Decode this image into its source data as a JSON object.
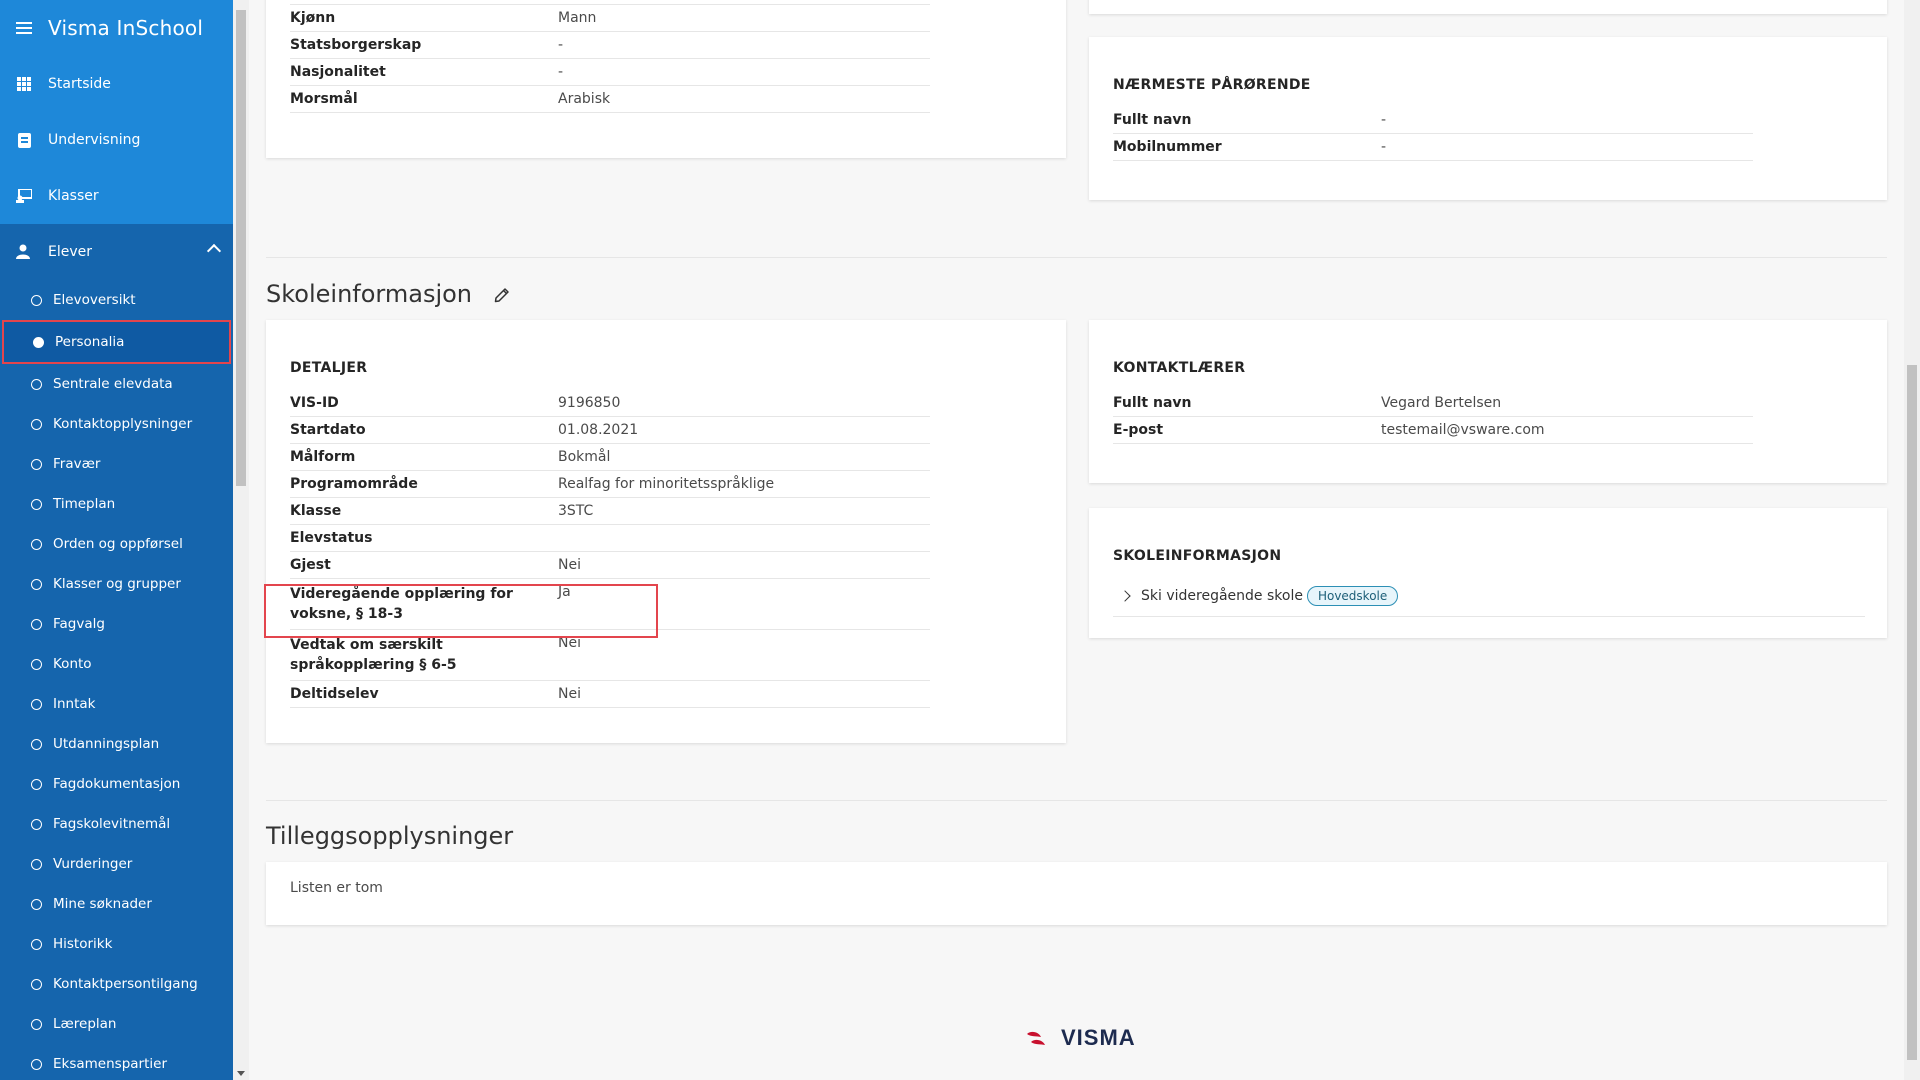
{
  "app": {
    "title": "Visma InSchool"
  },
  "sidebar": {
    "main_items": [
      {
        "label": "Startside",
        "icon": "grid-icon"
      },
      {
        "label": "Undervisning",
        "icon": "book-icon"
      },
      {
        "label": "Klasser",
        "icon": "classroom-icon"
      }
    ],
    "elever": {
      "label": "Elever",
      "icon": "students-icon"
    },
    "sub_items": [
      "Elevoversikt",
      "Personalia",
      "Sentrale elevdata",
      "Kontaktopplysninger",
      "Fravær",
      "Timeplan",
      "Orden og oppførsel",
      "Klasser og grupper",
      "Fagvalg",
      "Konto",
      "Inntak",
      "Utdanningsplan",
      "Fagdokumentasjon",
      "Fagskolevitnemål",
      "Vurderinger",
      "Mine søknader",
      "Historikk",
      "Kontaktpersontilgang",
      "Læreplan",
      "Eksamenspartier"
    ],
    "active_item": "Personalia"
  },
  "personal": {
    "rows": [
      {
        "k": "Kjønn",
        "v": "Mann"
      },
      {
        "k": "Statsborgerskap",
        "v": "-"
      },
      {
        "k": "Nasjonalitet",
        "v": "-"
      },
      {
        "k": "Morsmål",
        "v": "Arabisk"
      }
    ]
  },
  "naermeste": {
    "heading": "NÆRMESTE PÅRØRENDE",
    "rows": [
      {
        "k": "Fullt navn",
        "v": "-"
      },
      {
        "k": "Mobilnummer",
        "v": "-"
      }
    ]
  },
  "skoleinfo_section": {
    "title": "Skoleinformasjon"
  },
  "detaljer": {
    "heading": "DETALJER",
    "rows": [
      {
        "k": "VIS-ID",
        "v": "9196850"
      },
      {
        "k": "Startdato",
        "v": "01.08.2021"
      },
      {
        "k": "Målform",
        "v": "Bokmål"
      },
      {
        "k": "Programområde",
        "v": "Realfag for minoritetsspråklige"
      },
      {
        "k": "Klasse",
        "v": "3STC"
      },
      {
        "k": "Elevstatus",
        "v": ""
      },
      {
        "k": "Gjest",
        "v": "Nei"
      },
      {
        "k": "Videregående opplæring for voksne, § 18-3",
        "v": "Ja"
      },
      {
        "k": "Vedtak om særskilt språkopplæring § 6-5",
        "v": "Nei"
      },
      {
        "k": "Deltidselev",
        "v": "Nei"
      }
    ]
  },
  "kontaktlaerer": {
    "heading": "KONTAKTLÆRER",
    "rows": [
      {
        "k": "Fullt navn",
        "v": "Vegard Bertelsen"
      },
      {
        "k": "E-post",
        "v": "testemail@vsware.com"
      }
    ]
  },
  "skoleinformasjon_card": {
    "heading": "SKOLEINFORMASJON",
    "school": "Ski videregående skole",
    "badge": "Hovedskole"
  },
  "tillegg": {
    "title": "Tilleggsopplysninger",
    "empty_text": "Listen er tom"
  },
  "footer": {
    "logo_text": "VISMA"
  },
  "colors": {
    "sidebar_top": "#1e88d9",
    "sidebar": "#1565ad",
    "highlight": "#e3454d"
  }
}
